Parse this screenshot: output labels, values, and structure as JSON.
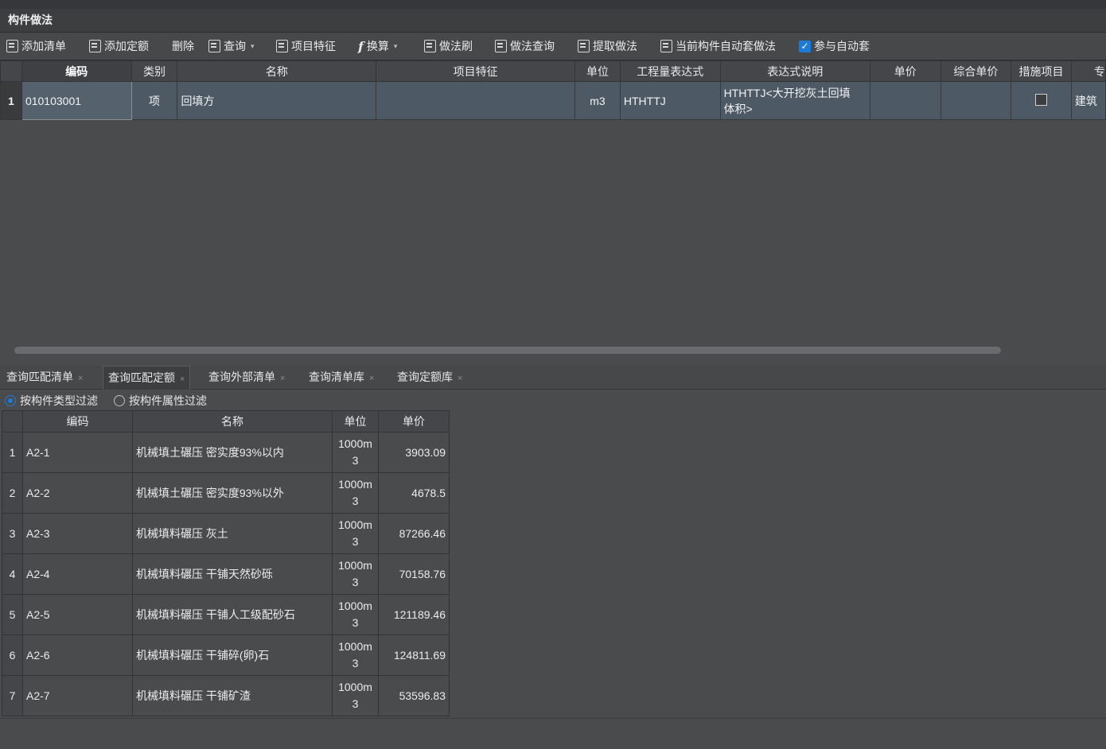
{
  "panel": {
    "title": "构件做法"
  },
  "toolbar": {
    "add_list": "添加清单",
    "add_quota": "添加定额",
    "delete": "删除",
    "query": "查询",
    "project_feature": "项目特征",
    "convert": "换算",
    "method_brush": "做法刷",
    "method_query": "做法查询",
    "extract_method": "提取做法",
    "auto_apply_current": "当前构件自动套做法",
    "participate_auto": "参与自动套",
    "participate_auto_checked": true
  },
  "upper_grid": {
    "columns": [
      "编码",
      "类别",
      "名称",
      "项目特征",
      "单位",
      "工程量表达式",
      "表达式说明",
      "单价",
      "综合单价",
      "措施项目",
      "专"
    ],
    "rows": [
      {
        "num": "1",
        "code": "010103001",
        "category": "项",
        "name": "回填方",
        "feature": "",
        "unit": "m3",
        "expr": "HTHTTJ",
        "expr_desc_1": "HTHTTJ<大开挖灰土回填",
        "expr_desc_2": "体积>",
        "price": "",
        "composite_price": "",
        "measure_checked": false,
        "specialty": "建筑"
      }
    ]
  },
  "tabs": [
    {
      "label": "查询匹配清单"
    },
    {
      "label": "查询匹配定额",
      "active": true
    },
    {
      "label": "查询外部清单"
    },
    {
      "label": "查询清单库"
    },
    {
      "label": "查询定额库"
    }
  ],
  "filters": {
    "by_type": "按构件类型过滤",
    "by_attr": "按构件属性过滤",
    "selected": "by_type"
  },
  "lower_grid": {
    "columns": [
      "编码",
      "名称",
      "单位",
      "单价"
    ],
    "rows": [
      {
        "num": "1",
        "code": "A2-1",
        "name": "机械填土碾压 密实度93%以内",
        "unit_1": "1000m",
        "unit_2": "3",
        "price": "3903.09"
      },
      {
        "num": "2",
        "code": "A2-2",
        "name": "机械填土碾压 密实度93%以外",
        "unit_1": "1000m",
        "unit_2": "3",
        "price": "4678.5"
      },
      {
        "num": "3",
        "code": "A2-3",
        "name": "机械填料碾压 灰土",
        "unit_1": "1000m",
        "unit_2": "3",
        "price": "87266.46"
      },
      {
        "num": "4",
        "code": "A2-4",
        "name": "机械填料碾压 干铺天然砂砾",
        "unit_1": "1000m",
        "unit_2": "3",
        "price": "70158.76"
      },
      {
        "num": "5",
        "code": "A2-5",
        "name": "机械填料碾压 干铺人工级配砂石",
        "unit_1": "1000m",
        "unit_2": "3",
        "price": "121189.46"
      },
      {
        "num": "6",
        "code": "A2-6",
        "name": "机械填料碾压 干铺碎(卵)石",
        "unit_1": "1000m",
        "unit_2": "3",
        "price": "124811.69"
      },
      {
        "num": "7",
        "code": "A2-7",
        "name": "机械填料碾压 干铺矿渣",
        "unit_1": "1000m",
        "unit_2": "3",
        "price": "53596.83"
      }
    ]
  },
  "colors": {
    "accent": "#1f7ad6",
    "selected_row": "#4d5a66",
    "background": "#4a4b4d"
  }
}
